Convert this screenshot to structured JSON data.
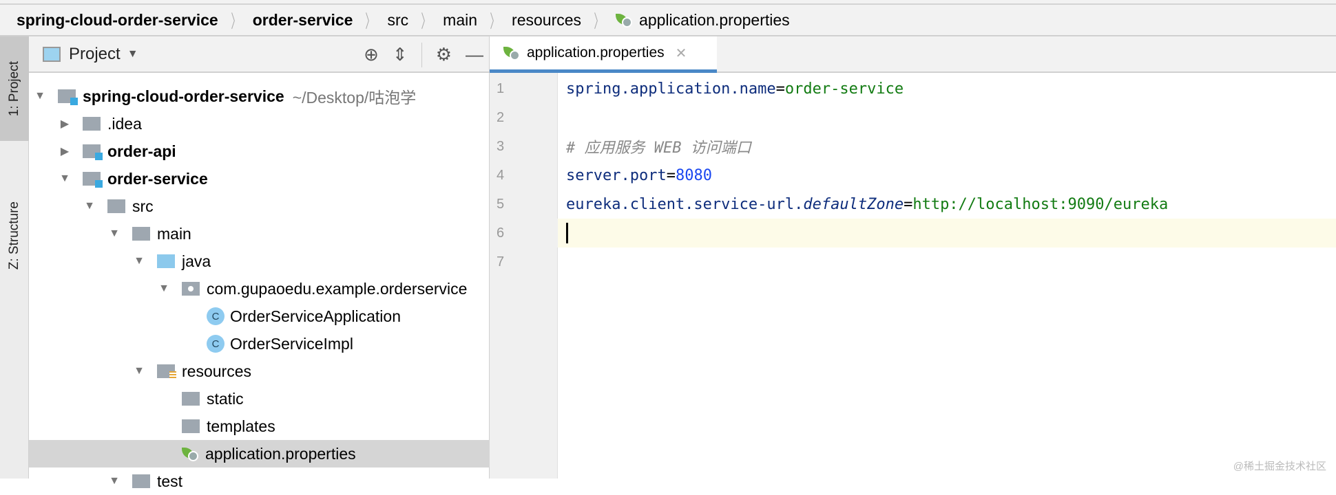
{
  "breadcrumb": [
    "spring-cloud-order-service",
    "order-service",
    "src",
    "main",
    "resources",
    "application.properties"
  ],
  "toolstrip": {
    "project": "1: Project",
    "structure": "Z: Structure"
  },
  "panel": {
    "title": "Project"
  },
  "tree": [
    {
      "label": "spring-cloud-order-service",
      "path": "~/Desktop/咕泡学"
    },
    {
      "label": ".idea"
    },
    {
      "label": "order-api"
    },
    {
      "label": "order-service"
    },
    {
      "label": "src"
    },
    {
      "label": "main"
    },
    {
      "label": "java"
    },
    {
      "label": "com.gupaoedu.example.orderservice"
    },
    {
      "label": "OrderServiceApplication",
      "icon": "C"
    },
    {
      "label": "OrderServiceImpl",
      "icon": "C"
    },
    {
      "label": "resources"
    },
    {
      "label": "static"
    },
    {
      "label": "templates"
    },
    {
      "label": "application.properties"
    },
    {
      "label": "test"
    }
  ],
  "editor": {
    "tab": "application.properties",
    "lines": [
      {
        "n": "1",
        "key": "spring.application.name",
        "eq": "=",
        "val": "order-service"
      },
      {
        "n": "2"
      },
      {
        "n": "3",
        "comment": "# 应用服务 WEB 访问端口"
      },
      {
        "n": "4",
        "key": "server.port",
        "eq": "=",
        "num": "8080"
      },
      {
        "n": "5",
        "key": "eureka.client.service-url.",
        "ikey": "defaultZone",
        "eq": "=",
        "val": "http://localhost:9090/eureka"
      },
      {
        "n": "6"
      },
      {
        "n": "7"
      }
    ]
  },
  "watermark": "@稀土掘金技术社区"
}
